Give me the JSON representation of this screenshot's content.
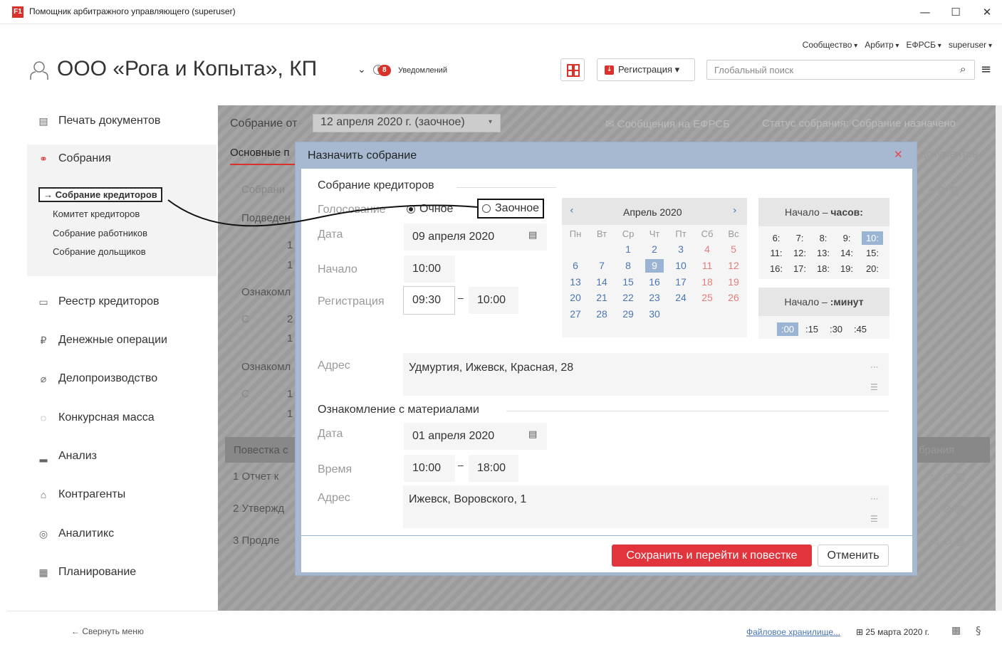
{
  "window": {
    "title": "Помощник арбитражного управляющего (superuser)",
    "logo": "F1",
    "minimize": "—",
    "maximize": "☐",
    "close": "✕"
  },
  "topmenu": [
    "Сообщество",
    "Арбитр",
    "ЕФРСБ",
    "superuser"
  ],
  "header": {
    "org_title": "ООО «Рога и Копыта», КП",
    "chevron": "⌄",
    "info": "i",
    "notif_count": "8",
    "notif_label": "Уведомлений",
    "reg_button": "Регистрация ▾",
    "search_placeholder": "Глобальный поиск",
    "search_icon": "⌕",
    "menu_icon": "≡"
  },
  "sidebar": {
    "items": [
      {
        "label": "Печать документов",
        "icon": "▤"
      },
      {
        "label": "Собрания",
        "icon": "⚭"
      },
      {
        "label": "Реестр кредиторов",
        "icon": "▭"
      },
      {
        "label": "Денежные операции",
        "icon": "₽"
      },
      {
        "label": "Делопроизводство",
        "icon": "⌀"
      },
      {
        "label": "Конкурсная масса",
        "icon": "◌"
      },
      {
        "label": "Анализ",
        "icon": "▂"
      },
      {
        "label": "Контрагенты",
        "icon": "⌂"
      },
      {
        "label": "Аналитикс",
        "icon": "◎"
      },
      {
        "label": "Планирование",
        "icon": "▦"
      }
    ],
    "sub_items": [
      "→ Собрание кредиторов",
      "Комитет кредиторов",
      "Собрание работников",
      "Собрание дольщиков"
    ],
    "collapse": "←  Свернуть меню"
  },
  "main": {
    "meeting_label": "Собрание от",
    "meeting_value": "12 апреля 2020 г. (заочное)",
    "efrsb_msg": "✉ Сообщения на ЕФРСБ",
    "status": "Статус собрания: Собрание назначено",
    "bg": {
      "tab_main": "Основные п",
      "tab_docs": "документов",
      "meeting": "Собрани",
      "summing": "Подведен",
      "acq1": "Ознакомл",
      "acq2": "Ознакомл",
      "c1": "С",
      "c2": "С",
      "n1": "1",
      "n2": "1",
      "n3": "2",
      "n4": "1",
      "n5": "1",
      "n6": "1",
      "agenda": "Повестка с",
      "agenda_right": "брания",
      "row1": "1   Отчет к",
      "row2": "2   Утвержд",
      "row3": "3   Продле",
      "tools": "+ ⊘ ▥",
      "row_tools": "↑↓ ⊘ ▥"
    }
  },
  "modal": {
    "title": "Назначить собрание",
    "close": "✕",
    "sec1": "Собрание кредиторов",
    "voting_label": "Голосование",
    "opt_inperson": "Очное",
    "opt_absentee": "Заочное",
    "date_label": "Дата",
    "date_value": "09 апреля 2020",
    "start_label": "Начало",
    "start_value": "10:00",
    "reg_label": "Регистрация",
    "reg_from": "09:30",
    "reg_dash": "–",
    "reg_to": "10:00",
    "addr_label": "Адрес",
    "addr_value": "Удмуртия, Ижевск, Красная, 28",
    "sec2": "Ознакомление с материалами",
    "date2_label": "Дата",
    "date2_value": "01 апреля 2020",
    "time_label": "Время",
    "time_from": "10:00",
    "time_to": "18:00",
    "addr2_label": "Адрес",
    "addr2_value": "Ижевск, Воровского, 1",
    "dots": "···",
    "list_icon": "☰",
    "cal_icon": "▤",
    "save": "Сохранить и перейти к повестке",
    "cancel": "Отменить",
    "calendar": {
      "month": "Апрель 2020",
      "prev": "‹",
      "next": "›",
      "dow": [
        "Пн",
        "Вт",
        "Ср",
        "Чт",
        "Пт",
        "Сб",
        "Вс"
      ],
      "selected_day": 9,
      "weeks": [
        [
          null,
          null,
          1,
          2,
          3,
          4,
          5
        ],
        [
          6,
          7,
          8,
          9,
          10,
          11,
          12
        ],
        [
          13,
          14,
          15,
          16,
          17,
          18,
          19
        ],
        [
          20,
          21,
          22,
          23,
          24,
          25,
          26
        ],
        [
          27,
          28,
          29,
          30,
          null,
          null,
          null
        ]
      ]
    },
    "hours_head_prefix": "Начало – ",
    "hours_head_bold": "часов:",
    "hours": [
      "6:",
      "7:",
      "8:",
      "9:",
      "10:",
      "11:",
      "12:",
      "13:",
      "14:",
      "15:",
      "16:",
      "17:",
      "18:",
      "19:",
      "20:"
    ],
    "hours_selected": "10:",
    "minutes_head_prefix": "Начало – ",
    "minutes_head_bold": ":минут",
    "minutes": [
      ":00",
      ":15",
      ":30",
      ":45"
    ],
    "minutes_selected": ":00"
  },
  "footer": {
    "file_link": "Файловое хранилище...",
    "date": "⊞ 25 марта 2020 г.",
    "calc_icon": "▦",
    "law_icon": "§"
  }
}
